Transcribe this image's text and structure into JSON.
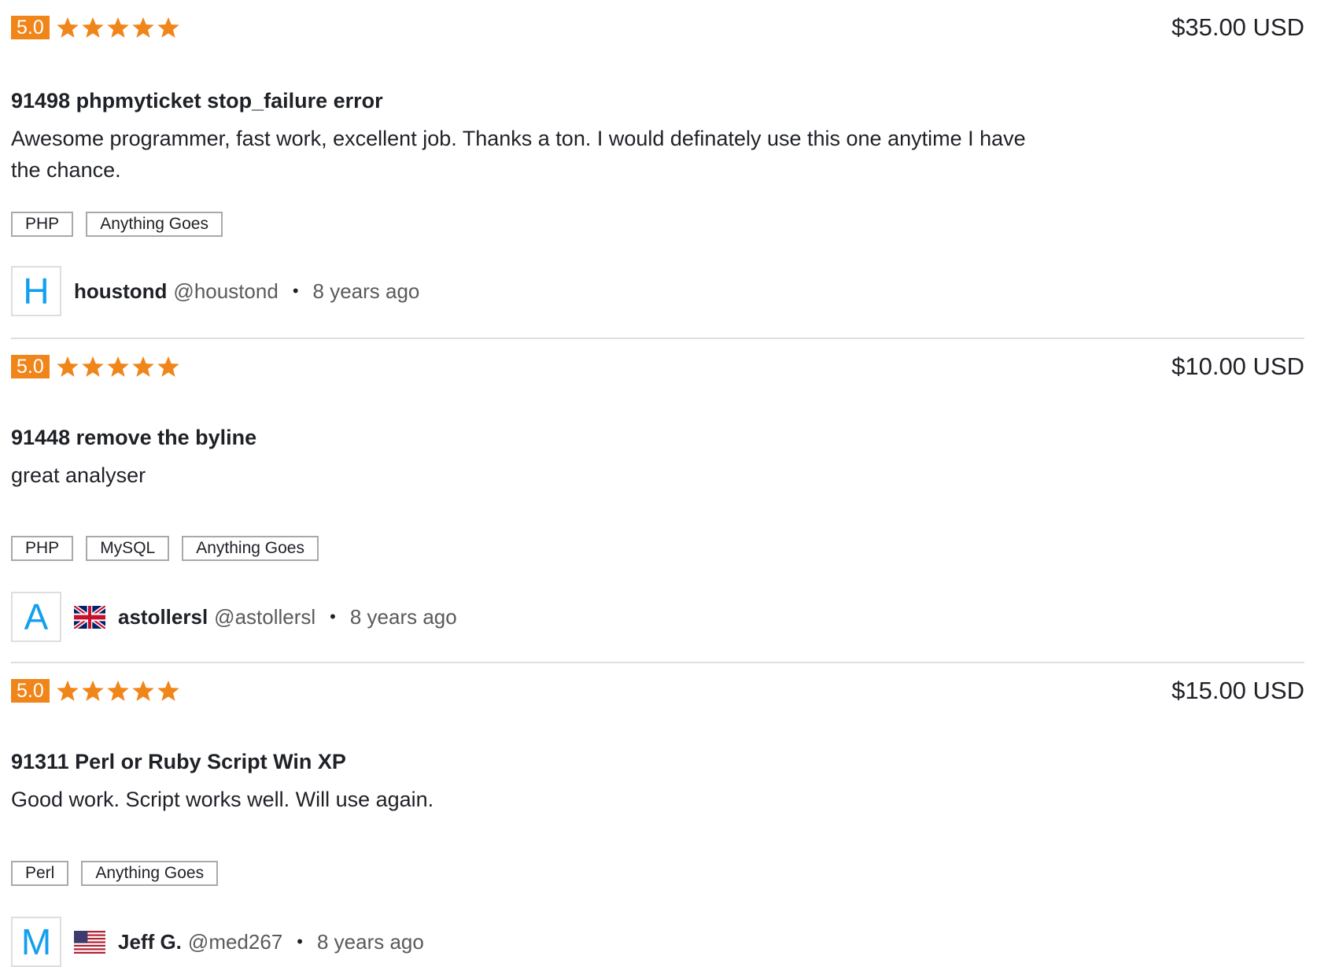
{
  "colors": {
    "rating_badge": "#f0851a",
    "star": "#f0851a",
    "avatar_letter": "#139ff0",
    "text_primary": "#1f2127",
    "text_muted": "#5a5a5a",
    "tag_border": "#a9a9a9",
    "divider": "#dedede"
  },
  "reviews": [
    {
      "rating": "5.0",
      "stars": 5,
      "price": "$35.00 USD",
      "title": "91498 phpmyticket stop_failure error",
      "description": "Awesome programmer, fast work, excellent job. Thanks a ton. I would definately use this one anytime I have the chance.",
      "skills": [
        "PHP",
        "Anything Goes"
      ],
      "reviewer": {
        "avatar_letter": "H",
        "flag": null,
        "name": "houstond",
        "handle": "@houstond",
        "separator": "•",
        "time": "8 years ago"
      }
    },
    {
      "rating": "5.0",
      "stars": 5,
      "price": "$10.00 USD",
      "title": "91448 remove the byline",
      "description": "great analyser",
      "skills": [
        "PHP",
        "MySQL",
        "Anything Goes"
      ],
      "reviewer": {
        "avatar_letter": "A",
        "flag": "uk-flag-icon",
        "name": "astollersl",
        "handle": "@astollersl",
        "separator": "•",
        "time": "8 years ago"
      }
    },
    {
      "rating": "5.0",
      "stars": 5,
      "price": "$15.00 USD",
      "title": "91311 Perl or Ruby Script Win XP",
      "description": "Good work. Script works well. Will use again.",
      "skills": [
        "Perl",
        "Anything Goes"
      ],
      "reviewer": {
        "avatar_letter": "M",
        "flag": "us-flag-icon",
        "name": "Jeff G.",
        "handle": "@med267",
        "separator": "•",
        "time": "8 years ago"
      }
    }
  ]
}
